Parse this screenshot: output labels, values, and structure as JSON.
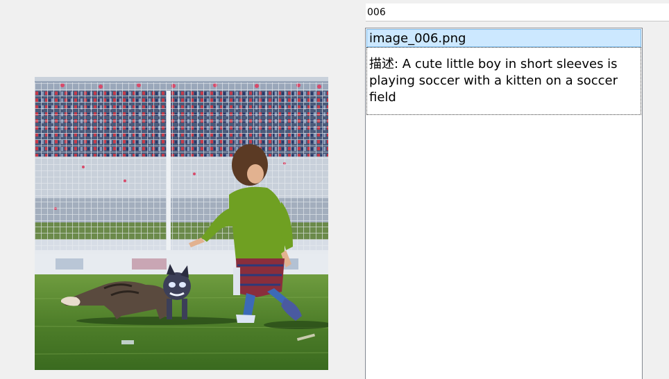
{
  "search": {
    "value": "006"
  },
  "preview": {
    "icon": "image-preview"
  },
  "results": [
    {
      "filename": "image_006.png",
      "desc_label": "描述: ",
      "desc_text": "A cute little boy in short sleeves is playing soccer with a kitten on a soccer field"
    }
  ],
  "colors": {
    "window_bg": "#f0f0f0",
    "selection_bg": "#cce8ff",
    "selection_border": "#7ab7e6",
    "list_border": "#828790"
  }
}
